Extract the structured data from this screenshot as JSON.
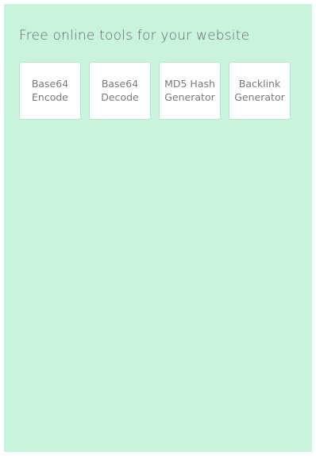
{
  "page": {
    "heading": "Free online tools for your website"
  },
  "tools": [
    {
      "label": "Base64\nEncode"
    },
    {
      "label": "Base64\nDecode"
    },
    {
      "label": "MD5 Hash\nGenerator"
    },
    {
      "label": "Backlink\nGenerator"
    }
  ],
  "colors": {
    "background": "#c9f3dc",
    "card": "#ffffff",
    "text": "#7a7a7a"
  }
}
